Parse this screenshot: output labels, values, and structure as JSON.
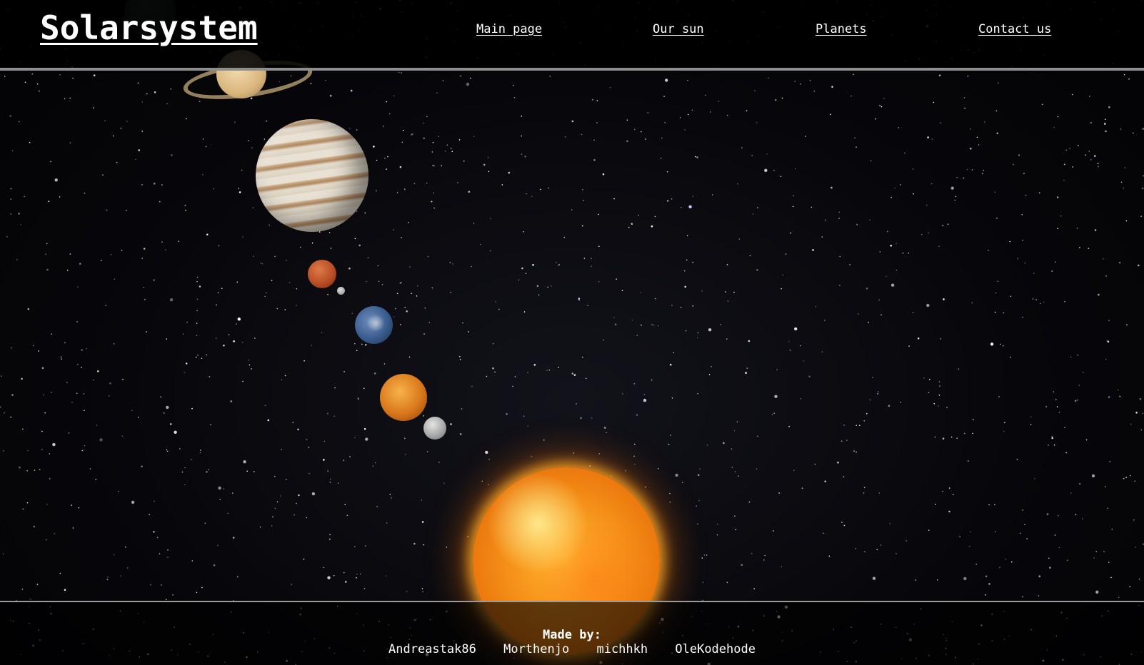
{
  "header": {
    "site_title": "Solarsystem",
    "nav": {
      "main_page": "Main page",
      "our_sun": "Our sun",
      "planets": "Planets",
      "contact_us": "Contact us"
    }
  },
  "footer": {
    "made_by_label": "Made by:",
    "authors": [
      "Andreastak86",
      "Morthenjo",
      "michhkh",
      "OleKodehode"
    ]
  },
  "colors": {
    "background": "#050508",
    "text": "#ffffff",
    "rule": "#8e8e8e"
  }
}
